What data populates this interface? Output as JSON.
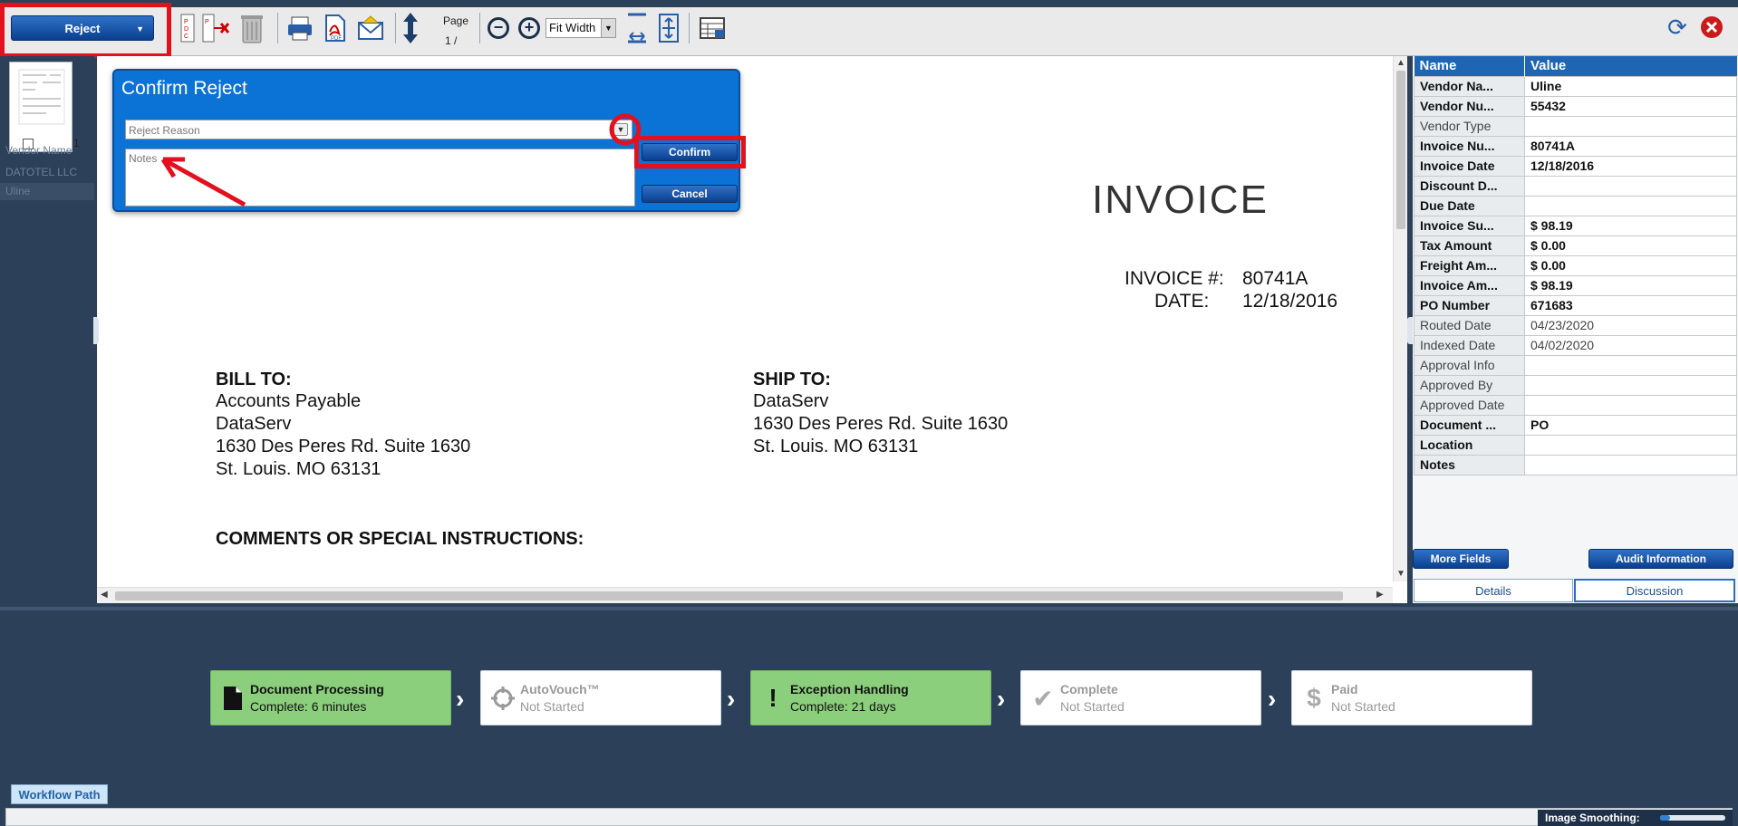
{
  "toolbar": {
    "reject_label": "Reject",
    "page_label": "Page",
    "page_sub": "1 /",
    "zoom_value": "Fit Width"
  },
  "thumbnails": {
    "page_number": "1",
    "hidden_list": [
      "Vendor Name",
      "DATOTEL LLC",
      "Uline"
    ]
  },
  "dialog": {
    "title": "Confirm Reject",
    "reason_placeholder": "Reject Reason",
    "notes_placeholder": "Notes",
    "confirm_label": "Confirm",
    "cancel_label": "Cancel"
  },
  "document": {
    "heading": "INVOICE",
    "invoice_no_label": "INVOICE #:",
    "invoice_no": "80741A",
    "date_label": "DATE:",
    "date": "12/18/2016",
    "bill_to_label": "BILL TO:",
    "bill_to": [
      "Accounts Payable",
      "DataServ",
      "1630 Des Peres Rd. Suite 1630",
      "St. Louis. MO 63131"
    ],
    "ship_to_label": "SHIP TO:",
    "ship_to": [
      "DataServ",
      "1630 Des Peres Rd. Suite 1630",
      "St. Louis. MO 63131"
    ],
    "comments_label": "COMMENTS OR SPECIAL INSTRUCTIONS:"
  },
  "fields": {
    "headers": [
      "Name",
      "Value"
    ],
    "rows": [
      {
        "name": "Vendor Na...",
        "value": "Uline",
        "bold": true
      },
      {
        "name": "Vendor Nu...",
        "value": "55432",
        "bold": true
      },
      {
        "name": "Vendor Type",
        "value": "",
        "bold": false
      },
      {
        "name": "Invoice Nu...",
        "value": "80741A",
        "bold": true
      },
      {
        "name": "Invoice Date",
        "value": "12/18/2016",
        "bold": true
      },
      {
        "name": "Discount D...",
        "value": "",
        "bold": true
      },
      {
        "name": "Due Date",
        "value": "",
        "bold": true
      },
      {
        "name": "Invoice Su...",
        "value": "$ 98.19",
        "bold": true
      },
      {
        "name": "Tax Amount",
        "value": "$ 0.00",
        "bold": true
      },
      {
        "name": "Freight Am...",
        "value": "$ 0.00",
        "bold": true
      },
      {
        "name": "Invoice Am...",
        "value": "$ 98.19",
        "bold": true
      },
      {
        "name": "PO Number",
        "value": "671683",
        "bold": true
      },
      {
        "name": "Routed Date",
        "value": "04/23/2020",
        "bold": false
      },
      {
        "name": "Indexed Date",
        "value": "04/02/2020",
        "bold": false
      },
      {
        "name": "Approval Info",
        "value": "",
        "bold": false
      },
      {
        "name": "Approved By",
        "value": "",
        "bold": false
      },
      {
        "name": "Approved Date",
        "value": "",
        "bold": false
      },
      {
        "name": "Document ...",
        "value": "PO",
        "bold": true
      },
      {
        "name": "Location",
        "value": "",
        "bold": true
      },
      {
        "name": "Notes",
        "value": "",
        "bold": true
      }
    ],
    "more_fields_label": "More Fields",
    "audit_label": "Audit Information",
    "tabs": [
      "Details",
      "Discussion"
    ]
  },
  "workflow": {
    "steps": [
      {
        "title": "Document Processing",
        "status": "Complete: 6 minutes",
        "icon": "document-icon",
        "done": true
      },
      {
        "title": "AutoVouch™",
        "status": "Not Started",
        "icon": "crosshair-icon",
        "done": false
      },
      {
        "title": "Exception Handling",
        "status": "Complete: 21 days",
        "icon": "exclamation-icon",
        "done": true
      },
      {
        "title": "Complete",
        "status": "Not Started",
        "icon": "checkmark-icon",
        "done": false
      },
      {
        "title": "Paid",
        "status": "Not Started",
        "icon": "dollar-icon",
        "done": false
      }
    ],
    "path_label": "Workflow Path",
    "smoothing_label": "Image Smoothing:",
    "smoothing_level": 0.15
  },
  "colors": {
    "accent": "#0b72d6",
    "highlight": "#e3101e",
    "complete": "#8bcf7c",
    "background": "#2c4159"
  }
}
